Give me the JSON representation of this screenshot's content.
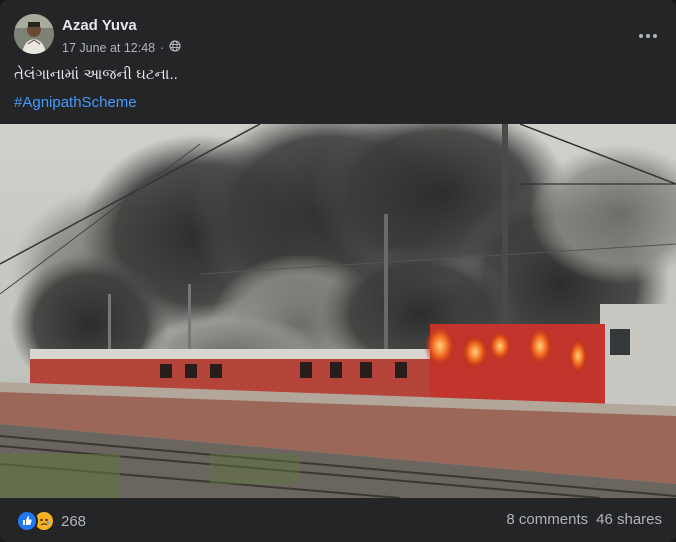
{
  "post": {
    "author": "Azad Yuva",
    "date": "17 June at 12:48",
    "separator": "·",
    "audience_icon": "globe-icon",
    "caption": "તેલંગાનામાં આજની ઘટના..",
    "hashtag": "#AgnipathScheme",
    "media_description_icon": "video-still",
    "reaction_icons": [
      "like-icon",
      "sad-icon"
    ],
    "reaction_count": "268",
    "comments": "8 comments",
    "shares": "46 shares"
  },
  "colors": {
    "card_bg": "#242526",
    "text_primary": "#e4e6eb",
    "text_secondary": "#b0b3b8",
    "link": "#4599ff",
    "like_blue": "#2078f4",
    "sad_yellow": "#f7b125"
  }
}
